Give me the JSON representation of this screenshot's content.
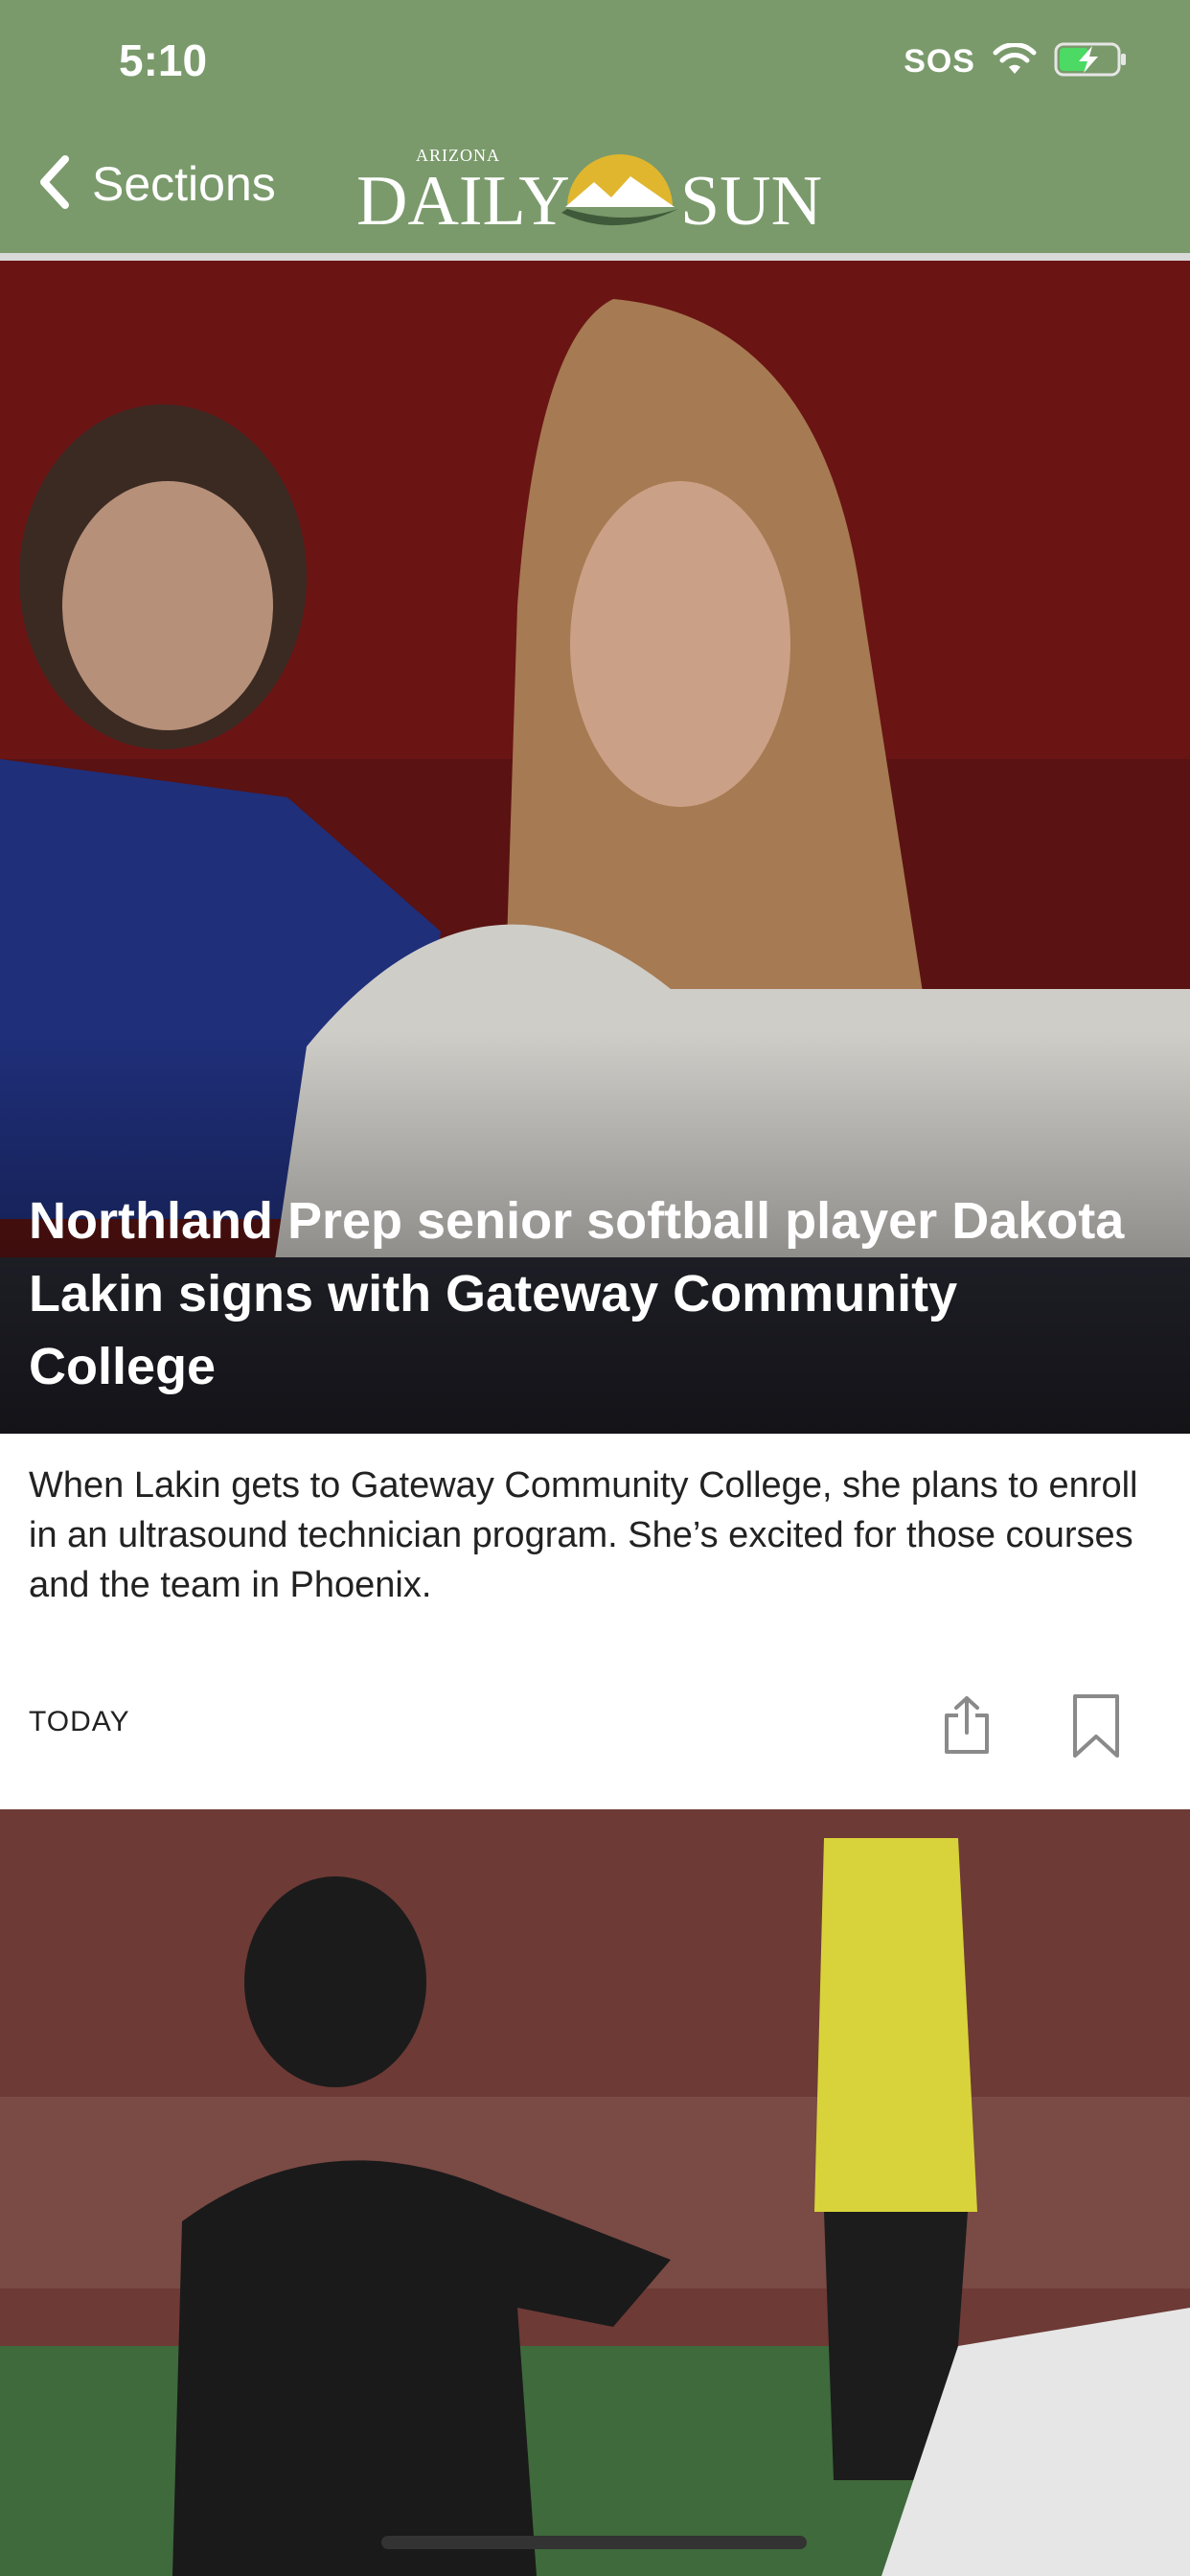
{
  "status_bar": {
    "time": "5:10",
    "sos_label": "SOS"
  },
  "nav": {
    "back_label": "Sections"
  },
  "logo": {
    "small_text": "ARIZONA",
    "word_left": "DAILY",
    "word_right": "SUN"
  },
  "articles": [
    {
      "headline": "Northland Prep senior softball player Dakota Lakin signs with Gateway Community College",
      "summary": "When Lakin gets to Gateway Community College, she plans to enroll in an ultrasound technician program. She’s excited for those courses and the team in Phoenix.",
      "date": "TODAY"
    }
  ],
  "colors": {
    "header_bg": "#7a9a6b",
    "battery_charge": "#4cd964"
  },
  "icons": [
    "chevron-left-icon",
    "wifi-icon",
    "battery-charging-icon",
    "share-icon",
    "bookmark-icon"
  ]
}
